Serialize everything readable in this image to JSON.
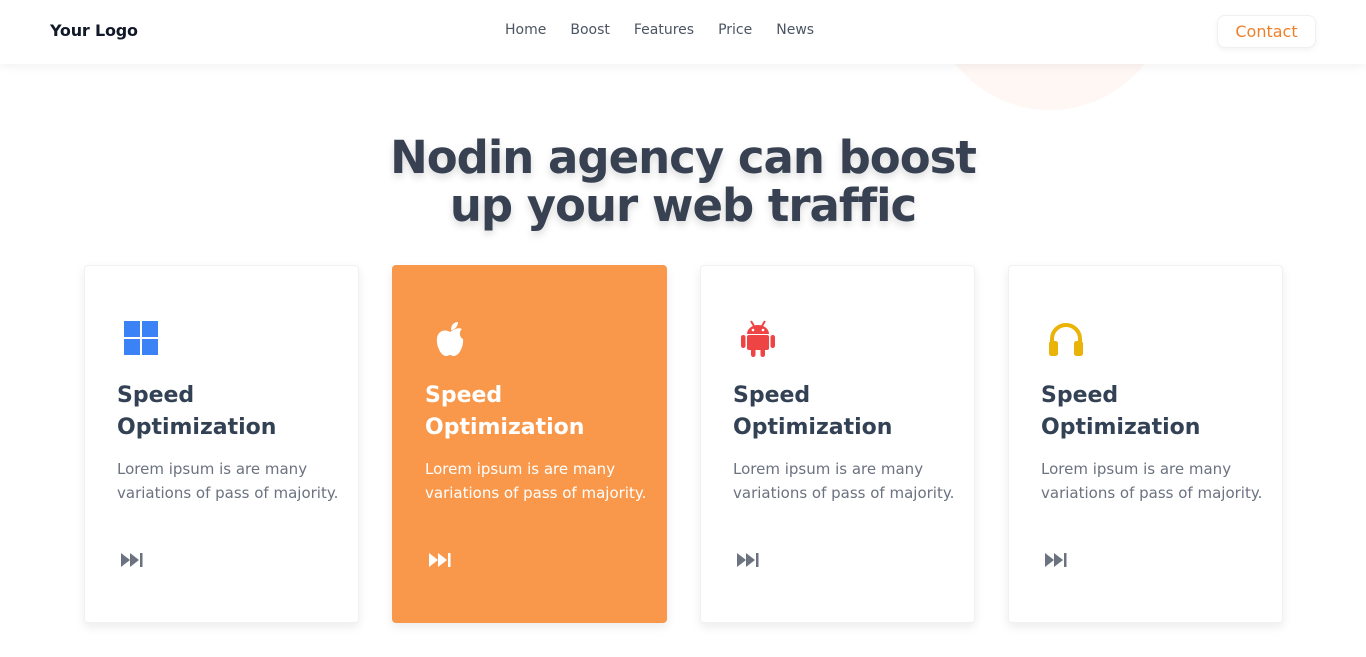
{
  "header": {
    "logo": "Your Logo",
    "nav": [
      "Home",
      "Boost",
      "Features",
      "Price",
      "News"
    ],
    "contact_label": "Contact"
  },
  "hero": {
    "title_line1": "Nodin agency can boost",
    "title_line2": "up your web traffic"
  },
  "cards": [
    {
      "icon": "windows-icon",
      "title_line1": "Speed",
      "title_line2": "Optimization",
      "text": "Lorem ipsum is are many variations of pass of majority.",
      "active": false
    },
    {
      "icon": "apple-icon",
      "title_line1": "Speed",
      "title_line2": "Optimization",
      "text": "Lorem ipsum is are many variations of pass of majority.",
      "active": true
    },
    {
      "icon": "android-icon",
      "title_line1": "Speed",
      "title_line2": "Optimization",
      "text": "Lorem ipsum is are many variations of pass of majority.",
      "active": false
    },
    {
      "icon": "headphones-icon",
      "title_line1": "Speed",
      "title_line2": "Optimization",
      "text": "Lorem ipsum is are many variations of pass of majority.",
      "active": false
    }
  ],
  "colors": {
    "accent": "#f9984a",
    "contact_text": "#f07f2a",
    "windows": "#3b82f6",
    "android": "#ef4444",
    "headphones": "#eab308",
    "arrow_default": "#6b7280",
    "arrow_active": "#ffffff"
  }
}
